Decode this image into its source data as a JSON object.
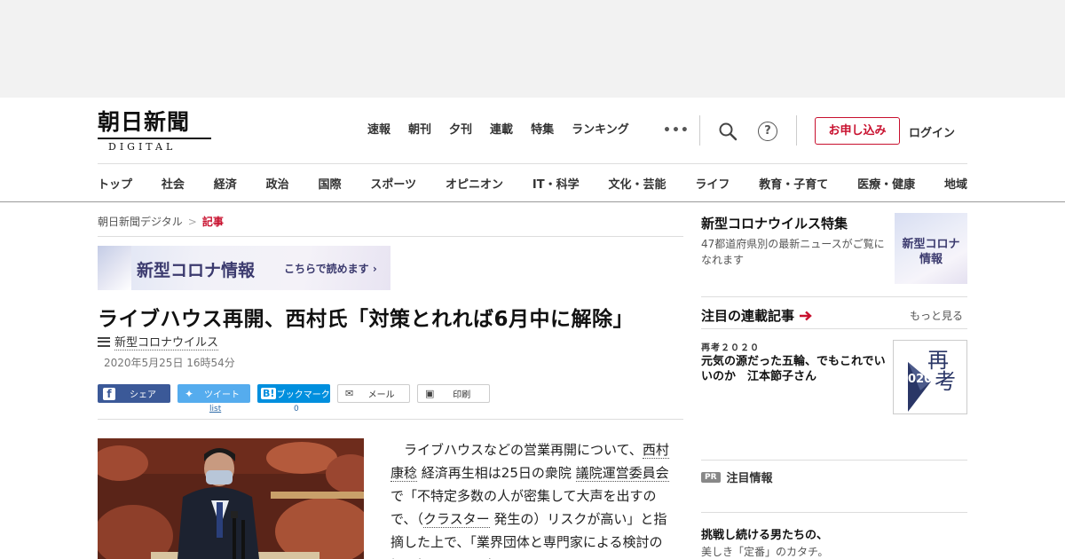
{
  "header": {
    "logo_title": "朝日新聞",
    "logo_sub": "DIGITAL",
    "topnav": [
      "速報",
      "朝刊",
      "夕刊",
      "連載",
      "特集",
      "ランキング"
    ],
    "more_glyph": "•••",
    "signup_label": "お申し込み",
    "login_label": "ログイン",
    "help_glyph": "?",
    "categories": [
      "トップ",
      "社会",
      "経済",
      "政治",
      "国際",
      "スポーツ",
      "オピニオン",
      "IT・科学",
      "文化・芸能",
      "ライフ",
      "教育・子育て",
      "医療・健康",
      "地域"
    ]
  },
  "breadcrumb": {
    "home": "朝日新聞デジタル",
    "separator": ">",
    "current": "記事"
  },
  "banner": {
    "main": "新型コロナ情報",
    "sub": "こちらで読めます"
  },
  "article": {
    "headline": "ライブハウス再開、西村氏「対策とれれば6月中に解除」",
    "tag": "新型コロナウイルス",
    "date": "2020年5月25日 16時54分",
    "share": {
      "facebook": "シェア",
      "twitter": "ツイート",
      "hatena": "ブックマーク",
      "mail": "メール",
      "print": "印刷",
      "twitter_count": "list",
      "hatena_count": "0"
    },
    "body": {
      "p1": "ライブハウスなどの営業再開について、",
      "l1": "西村康稔",
      "p2": " 経済再生相は25日の衆院 ",
      "l2": "議院運営委員会",
      "p3": " で「不特定多数の人が密集して大声を出すので、（",
      "l3": "クラスター",
      "p4": " 発生の）リスクが高い」と指摘した上で、「業界団体と専門家による検討の場を設けようと考え"
    }
  },
  "sidebar": {
    "feature_title": "新型コロナウイルス特集",
    "feature_desc": "47都道府県別の最新ニュースがご覧になれます",
    "feature_thumb": "新型コロナ\n情報",
    "serial_heading": "注目の連載記事",
    "serial_more": "もっと見る",
    "serial_kicker": "再考２０２０",
    "serial_article": "元気の源だった五輪、でもこれでいいのか　江本節子さん",
    "serial_thumb_a": "再",
    "serial_thumb_b": "考",
    "serial_thumb_year": "2020",
    "pr_badge": "PR",
    "pr_label": "注目情報",
    "ad_title": "挑戦し続ける男たちの、",
    "ad_sub": "美しき「定番」のカタチ。"
  },
  "colors": {
    "accent": "#c8102e",
    "facebook": "#3b5998",
    "twitter": "#55acee",
    "hatena": "#008fde",
    "banner_text": "#3b3a6e"
  }
}
